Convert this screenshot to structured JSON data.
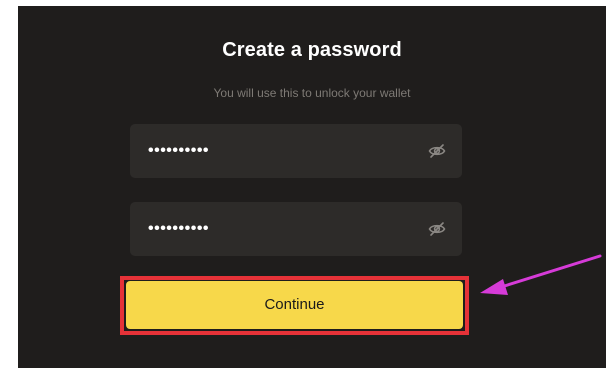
{
  "dialog": {
    "title": "Create a password",
    "subtitle": "You will use this to unlock your wallet"
  },
  "fields": [
    {
      "value": "••••••••••",
      "icon": "eye-off-icon"
    },
    {
      "value": "••••••••••",
      "icon": "eye-off-icon"
    }
  ],
  "continue_button": {
    "label": "Continue"
  },
  "colors": {
    "panel_background": "#1f1d1c",
    "field_background": "#2d2b29",
    "button_yellow": "#f7d84a",
    "highlight_red": "#e53238",
    "arrow_magenta": "#d63bd8"
  }
}
